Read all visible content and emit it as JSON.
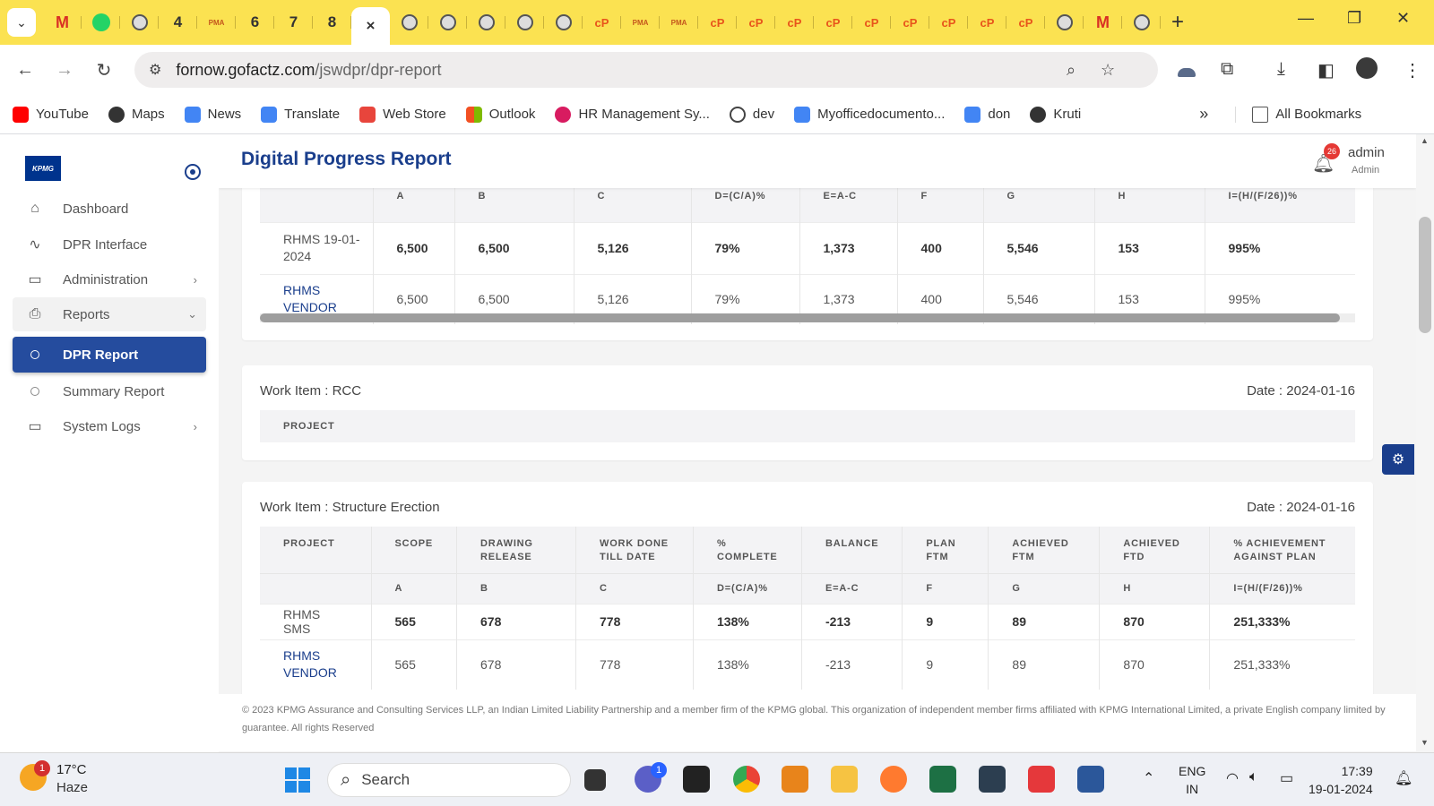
{
  "browser": {
    "tabs": [
      "M",
      "W",
      "",
      "4",
      "PMA",
      "6",
      "7",
      "8",
      "×",
      "",
      "",
      "",
      "",
      "",
      "oc",
      "PMA",
      "PMA",
      "oc",
      "oc",
      "oc",
      "oc",
      "oc",
      "oc",
      "oc",
      "oc",
      "",
      "",
      ""
    ],
    "tab_numbers": {
      "t4": "4",
      "t6": "6",
      "t7": "7",
      "t8": "8"
    },
    "close_glyph": "×",
    "new_tab": "+",
    "url_host": "fornow.gofactz.com",
    "url_path": "/jswdpr/dpr-report",
    "bookmarks": [
      "YouTube",
      "Maps",
      "News",
      "Translate",
      "Web Store",
      "Outlook",
      "HR Management Sy...",
      "dev",
      "Myofficedocumento...",
      "don",
      "Kruti"
    ],
    "bookmark_overflow": "»",
    "all_bookmarks": "All Bookmarks",
    "colors": {
      "tabbar": "#fbe251",
      "accent": "#1a3e8c"
    }
  },
  "sidebar": {
    "logo": "KPMG",
    "items": [
      {
        "label": "Dashboard",
        "icon": "home-icon"
      },
      {
        "label": "DPR Interface",
        "icon": "activity-icon"
      },
      {
        "label": "Administration",
        "icon": "monitor-icon"
      },
      {
        "label": "Reports",
        "icon": "printer-icon"
      },
      {
        "label": "DPR Report",
        "icon": "circle-icon"
      },
      {
        "label": "Summary Report",
        "icon": "circle-icon"
      },
      {
        "label": "System Logs",
        "icon": "monitor-icon"
      }
    ]
  },
  "header": {
    "title": "Digital Progress Report",
    "notification_count": "26",
    "user_name": "admin",
    "user_role": "Admin"
  },
  "card1": {
    "subheaders": [
      "A",
      "B",
      "C",
      "D=(C/A)%",
      "E=A-C",
      "F",
      "G",
      "H",
      "I=(H/(F/26))%"
    ],
    "rows": [
      {
        "project": "RHMS 19-01-2024",
        "values": [
          "6,500",
          "6,500",
          "5,126",
          "79%",
          "1,373",
          "400",
          "5,546",
          "153",
          "995%"
        ]
      },
      {
        "project": "RHMS VENDOR",
        "values": [
          "6,500",
          "6,500",
          "5,126",
          "79%",
          "1,373",
          "400",
          "5,546",
          "153",
          "995%"
        ]
      }
    ]
  },
  "card2": {
    "title": "Work Item : RCC",
    "date": "Date : 2024-01-16",
    "header": "PROJECT"
  },
  "card3": {
    "title": "Work Item : Structure Erection",
    "date": "Date : 2024-01-16",
    "headers": [
      "PROJECT",
      "SCOPE",
      "DRAWING RELEASE",
      "WORK DONE TILL DATE",
      "% COMPLETE",
      "BALANCE",
      "PLAN FTM",
      "ACHIEVED FTM",
      "ACHIEVED FTD",
      "% ACHIEVEMENT AGAINST PLAN"
    ],
    "subheaders": [
      "A",
      "B",
      "C",
      "D=(C/A)%",
      "E=A-C",
      "F",
      "G",
      "H",
      "I=(H/(F/26))%"
    ],
    "rows": [
      {
        "project": "RHMS SMS",
        "values": [
          "565",
          "678",
          "778",
          "138%",
          "-213",
          "9",
          "89",
          "870",
          "251,333%"
        ]
      },
      {
        "project": "RHMS VENDOR",
        "values": [
          "565",
          "678",
          "778",
          "138%",
          "-213",
          "9",
          "89",
          "870",
          "251,333%"
        ]
      }
    ]
  },
  "footer": "© 2023 KPMG Assurance and Consulting Services LLP, an Indian Limited Liability Partnership and a member firm of the KPMG global. This organization of independent member firms affiliated with KPMG International Limited, a private English company limited by guarantee. All rights Reserved",
  "taskbar": {
    "weather_badge": "1",
    "temperature": "17°C",
    "condition": "Haze",
    "search": "Search",
    "chat_badge": "1",
    "lang_1": "ENG",
    "lang_2": "IN",
    "time": "17:39",
    "date": "19-01-2024"
  }
}
